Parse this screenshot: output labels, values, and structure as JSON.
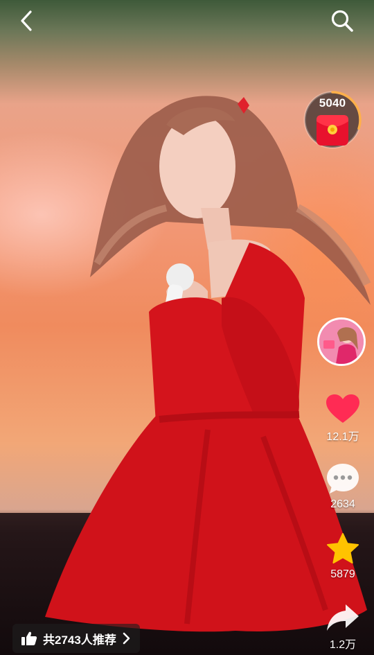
{
  "header": {
    "back_icon": "chevron-left-icon",
    "search_icon": "search-icon"
  },
  "reward": {
    "count": "5040",
    "icon": "red-envelope-icon",
    "progress_fraction": 0.3
  },
  "creator": {
    "avatar_icon": "creator-avatar"
  },
  "actions": {
    "like_count": "12.1万",
    "comment_count": "2634",
    "favorite_count": "5879",
    "share_count": "1.2万"
  },
  "recommend": {
    "text": "共2743人推荐",
    "icon": "thumbs-up-icon",
    "arrow_icon": "chevron-right-icon"
  },
  "colors": {
    "like": "#ff2b54",
    "favorite": "#ffc300",
    "reward_ring": "#ffb04a",
    "packet": "#e8112d"
  }
}
